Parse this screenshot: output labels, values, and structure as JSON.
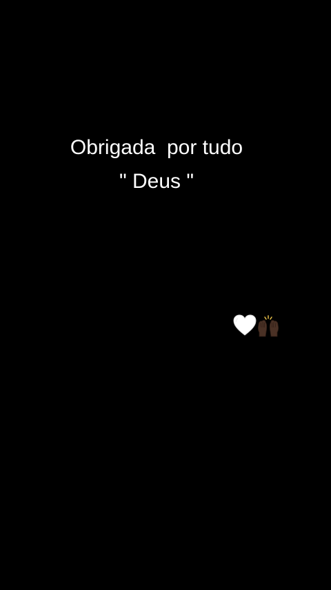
{
  "caption": {
    "line1": "Obrigada  por tudo",
    "line2": "\" Deus \""
  },
  "emojis": [
    {
      "name": "white-heart",
      "color": "#ffffff"
    },
    {
      "name": "raising-hands-dark-skin",
      "color": "#4a3125"
    }
  ],
  "colors": {
    "background": "#000000",
    "text": "#ffffff"
  }
}
